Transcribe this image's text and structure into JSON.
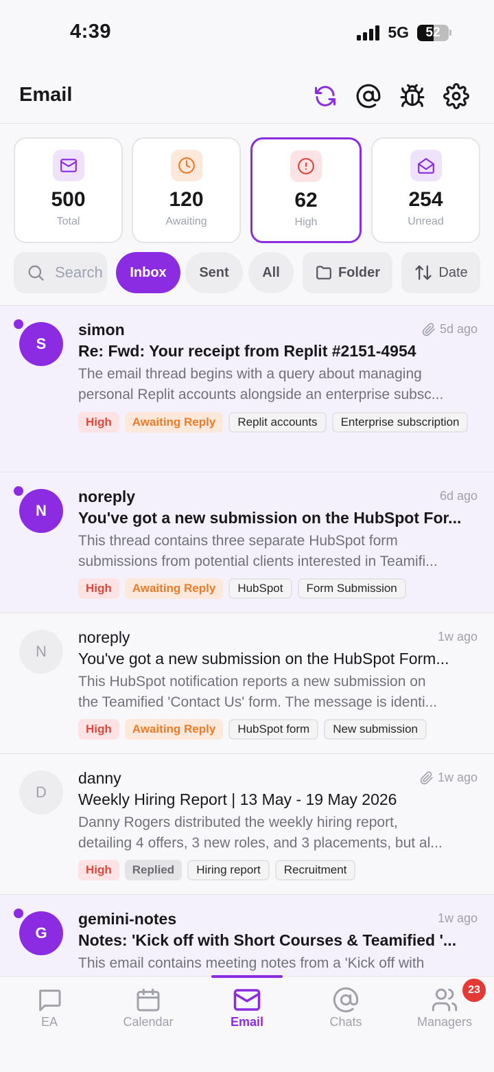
{
  "status_bar": {
    "time": "4:39",
    "network": "5G",
    "battery": "52",
    "battery_level": 0.52
  },
  "header": {
    "title": "Email",
    "actions": [
      {
        "name": "refresh-icon",
        "color": "#8b2be2"
      },
      {
        "name": "at-sign-icon",
        "color": "#18181b"
      },
      {
        "name": "bug-icon",
        "color": "#18181b"
      },
      {
        "name": "settings-icon",
        "color": "#18181b"
      }
    ]
  },
  "stats": [
    {
      "value": "500",
      "label": "Total",
      "icon": "mail-icon",
      "color": "#8b2be2",
      "bg": "#efe3fb",
      "active": false
    },
    {
      "value": "120",
      "label": "Awaiting",
      "icon": "clock-icon",
      "color": "#f07a23",
      "bg": "#fde9dc",
      "active": false
    },
    {
      "value": "62",
      "label": "High",
      "icon": "alert-circle-icon",
      "color": "#e0463a",
      "bg": "#fde3e3",
      "active": true
    },
    {
      "value": "254",
      "label": "Unread",
      "icon": "mail-open-icon",
      "color": "#8b2be2",
      "bg": "#efe3fb",
      "active": false
    }
  ],
  "filters": {
    "search_placeholder": "Search",
    "tabs": [
      "Inbox",
      "Sent",
      "All"
    ],
    "active_tab": "Inbox",
    "folder_label": "Folder",
    "sort_label": "Date"
  },
  "emails": [
    {
      "sender": "simon",
      "time": "5d ago",
      "attachment": true,
      "unread": true,
      "avatar": "S",
      "subject": "Re: Fwd: Your receipt from Replit #2151-4954",
      "preview_lines": [
        "The email thread begins with a query about managing",
        "personal Replit accounts alongside an enterprise subsc..."
      ],
      "tags": [
        {
          "text": "High",
          "kind": "high"
        },
        {
          "text": "Awaiting Reply",
          "kind": "await"
        },
        {
          "text": "Replit accounts",
          "kind": "topic"
        },
        {
          "text": "Enterprise subscription",
          "kind": "topic"
        }
      ]
    },
    {
      "sender": "noreply",
      "time": "6d ago",
      "attachment": false,
      "unread": true,
      "avatar": "N",
      "subject": "You've got a new submission on the HubSpot For...",
      "preview_lines": [
        "This thread contains three separate HubSpot form",
        "submissions from potential clients interested in Teamifi..."
      ],
      "tags": [
        {
          "text": "High",
          "kind": "high"
        },
        {
          "text": "Awaiting Reply",
          "kind": "await"
        },
        {
          "text": "HubSpot",
          "kind": "topic"
        },
        {
          "text": "Form Submission",
          "kind": "topic"
        }
      ]
    },
    {
      "sender": "noreply",
      "time": "1w ago",
      "attachment": false,
      "unread": false,
      "avatar": "N",
      "subject": "You've got a new submission on the HubSpot Form...",
      "preview_lines": [
        "This HubSpot notification reports a new submission on",
        "the Teamified 'Contact Us' form. The message is identi..."
      ],
      "tags": [
        {
          "text": "High",
          "kind": "high"
        },
        {
          "text": "Awaiting Reply",
          "kind": "await"
        },
        {
          "text": "HubSpot form",
          "kind": "topic"
        },
        {
          "text": "New submission",
          "kind": "topic"
        }
      ]
    },
    {
      "sender": "danny",
      "time": "1w ago",
      "attachment": true,
      "unread": false,
      "avatar": "D",
      "subject": "Weekly Hiring Report | 13 May - 19 May 2026",
      "preview_lines": [
        "Danny Rogers distributed the weekly hiring report,",
        "detailing 4 offers, 3 new roles, and 3 placements, but al..."
      ],
      "tags": [
        {
          "text": "High",
          "kind": "high"
        },
        {
          "text": "Replied",
          "kind": "replied"
        },
        {
          "text": "Hiring report",
          "kind": "topic"
        },
        {
          "text": "Recruitment",
          "kind": "topic"
        }
      ]
    },
    {
      "sender": "gemini-notes",
      "time": "1w ago",
      "attachment": false,
      "unread": true,
      "avatar": "G",
      "subject": "Notes: 'Kick off with Short Courses & Teamified '...",
      "preview_lines": [
        "This email contains meeting notes from a 'Kick off with",
        ""
      ],
      "tags": []
    }
  ],
  "bottom_nav": {
    "items": [
      {
        "label": "EA",
        "icon": "chat-bubble-icon"
      },
      {
        "label": "Calendar",
        "icon": "calendar-icon"
      },
      {
        "label": "Email",
        "icon": "mail-icon"
      },
      {
        "label": "Chats",
        "icon": "at-sign-icon"
      },
      {
        "label": "Managers",
        "icon": "users-icon"
      }
    ],
    "active": "Email",
    "managers_badge": "23"
  },
  "colors": {
    "accent": "#8b2be2",
    "high": "#e0463a",
    "awaiting": "#f07a23"
  }
}
